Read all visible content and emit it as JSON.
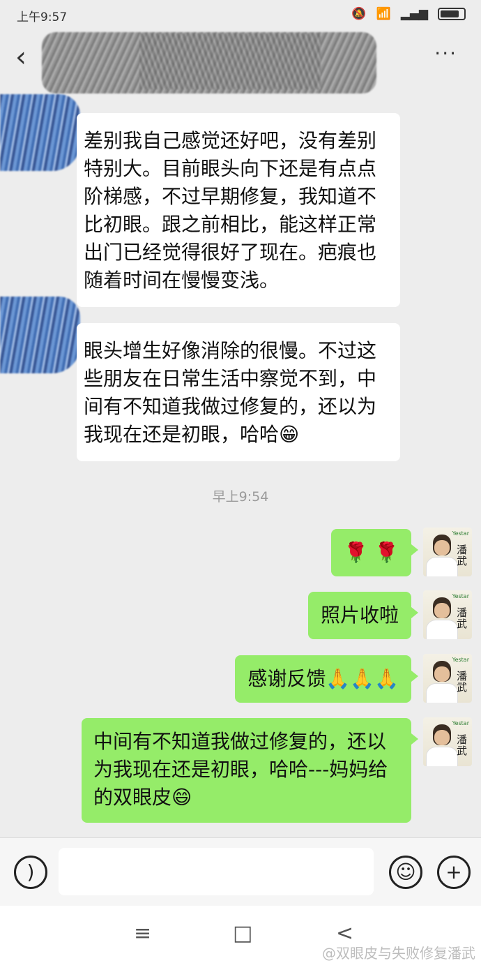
{
  "status_bar": {
    "time": "上午9:57",
    "mute_icon": "bell-off-icon",
    "wifi_icon": "wifi-icon",
    "signal_icon": "signal-icon",
    "battery_icon": "battery-icon"
  },
  "header": {
    "back_icon": "back-chevron-icon",
    "more_label": "···"
  },
  "messages_in": [
    {
      "text": "差别我自己感觉还好吧，没有差别特别大。目前眼头向下还是有点点阶梯感，不过早期修复，我知道不比初眼。跟之前相比，能这样正常出门已经觉得很好了现在。疤痕也随着时间在慢慢变浅。"
    },
    {
      "text": "眼头增生好像消除的很慢。不过这些朋友在日常生活中察觉不到，中间有不知道我做过修复的，还以为我现在还是初眼，哈哈😁"
    }
  ],
  "timestamp": "早上9:54",
  "messages_out": [
    {
      "text": "🌹 🌹"
    },
    {
      "text": "照片收啦"
    },
    {
      "text": "感谢反馈🙏🙏🙏"
    },
    {
      "text": "中间有不知道我做过修复的，还以为我现在还是初眼，哈哈---妈妈给的双眼皮😄"
    }
  ],
  "avatar": {
    "calligraphy": "潘武",
    "tag": "Yestar"
  },
  "input_bar": {
    "voice_icon": "voice-icon",
    "emoji_icon": "emoji-icon",
    "plus_icon": "plus-icon"
  },
  "nav": {
    "menu": "≡",
    "home": "□",
    "back": "<"
  },
  "watermark": "@双眼皮与失败修复潘武"
}
